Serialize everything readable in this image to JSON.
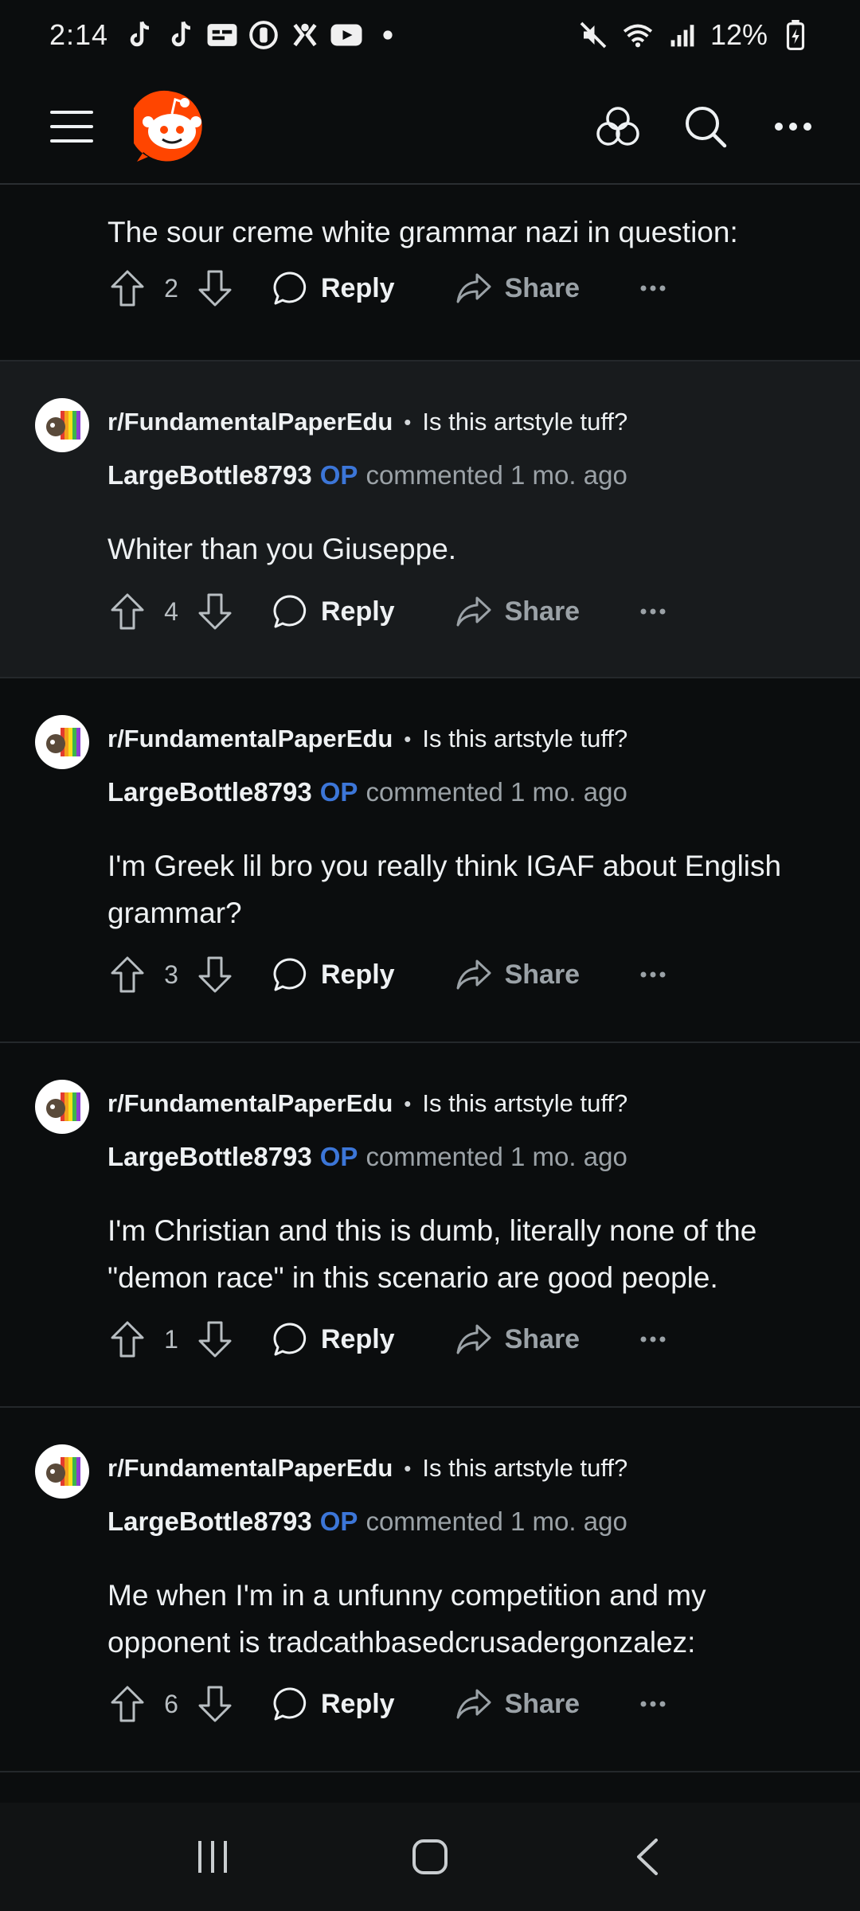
{
  "status_bar": {
    "time": "2:14",
    "battery": "12%",
    "icons_left": [
      "tiktok-icon",
      "tiktok-icon",
      "caption-icon",
      "clock-icon",
      "ghost-icon",
      "youtube-icon",
      "dot-icon"
    ],
    "icons_right": [
      "mute-icon",
      "wifi-icon",
      "signal-icon",
      "battery-icon"
    ]
  },
  "header": {
    "logo": "reddit-logo",
    "actions": [
      "communities-icon",
      "search-icon",
      "more-icon"
    ]
  },
  "first_comment": {
    "text": "The sour creme white grammar nazi in question:",
    "votes": "2",
    "reply_label": "Reply",
    "share_label": "Share"
  },
  "comments": [
    {
      "subreddit": "r/FundamentalPaperEdu",
      "post_title": "Is this artstyle tuff?",
      "username": "LargeBottle8793",
      "op_label": "OP",
      "meta": "commented 1 mo. ago",
      "text": "Whiter than you Giuseppe.",
      "votes": "4",
      "reply_label": "Reply",
      "share_label": "Share"
    },
    {
      "subreddit": "r/FundamentalPaperEdu",
      "post_title": "Is this artstyle tuff?",
      "username": "LargeBottle8793",
      "op_label": "OP",
      "meta": "commented 1 mo. ago",
      "text": "I'm Greek lil bro you really think IGAF about English grammar?",
      "votes": "3",
      "reply_label": "Reply",
      "share_label": "Share"
    },
    {
      "subreddit": "r/FundamentalPaperEdu",
      "post_title": "Is this artstyle tuff?",
      "username": "LargeBottle8793",
      "op_label": "OP",
      "meta": "commented 1 mo. ago",
      "text": "I'm Christian and this is dumb, literally none of the \"demon race\" in this scenario are good people.",
      "votes": "1",
      "reply_label": "Reply",
      "share_label": "Share"
    },
    {
      "subreddit": "r/FundamentalPaperEdu",
      "post_title": "Is this artstyle tuff?",
      "username": "LargeBottle8793",
      "op_label": "OP",
      "meta": "commented 1 mo. ago",
      "text": "Me when I'm in a unfunny competition and my opponent is tradcathbasedcrusadergonzalez:",
      "votes": "6",
      "reply_label": "Reply",
      "share_label": "Share"
    }
  ],
  "nav_bar": {
    "buttons": [
      "recents-icon",
      "home-icon",
      "back-icon"
    ]
  },
  "colors": {
    "background": "#0b0d0e",
    "highlight": "#181b1d",
    "op_blue": "#3c76d8",
    "reddit_orange": "#ff4500",
    "muted_text": "#9ba2a7"
  }
}
